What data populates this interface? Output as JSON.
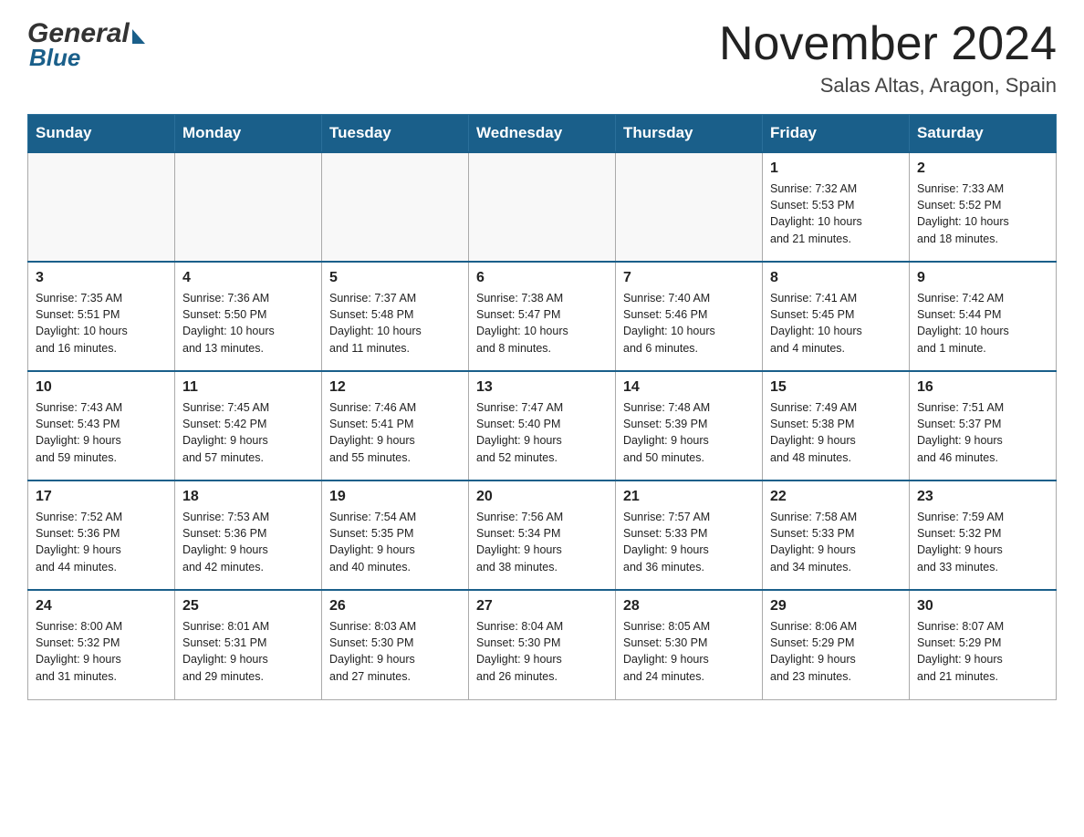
{
  "header": {
    "logo_general": "General",
    "logo_blue": "Blue",
    "month_year": "November 2024",
    "location": "Salas Altas, Aragon, Spain"
  },
  "weekdays": [
    "Sunday",
    "Monday",
    "Tuesday",
    "Wednesday",
    "Thursday",
    "Friday",
    "Saturday"
  ],
  "weeks": [
    {
      "days": [
        {
          "number": "",
          "info": ""
        },
        {
          "number": "",
          "info": ""
        },
        {
          "number": "",
          "info": ""
        },
        {
          "number": "",
          "info": ""
        },
        {
          "number": "",
          "info": ""
        },
        {
          "number": "1",
          "info": "Sunrise: 7:32 AM\nSunset: 5:53 PM\nDaylight: 10 hours\nand 21 minutes."
        },
        {
          "number": "2",
          "info": "Sunrise: 7:33 AM\nSunset: 5:52 PM\nDaylight: 10 hours\nand 18 minutes."
        }
      ]
    },
    {
      "days": [
        {
          "number": "3",
          "info": "Sunrise: 7:35 AM\nSunset: 5:51 PM\nDaylight: 10 hours\nand 16 minutes."
        },
        {
          "number": "4",
          "info": "Sunrise: 7:36 AM\nSunset: 5:50 PM\nDaylight: 10 hours\nand 13 minutes."
        },
        {
          "number": "5",
          "info": "Sunrise: 7:37 AM\nSunset: 5:48 PM\nDaylight: 10 hours\nand 11 minutes."
        },
        {
          "number": "6",
          "info": "Sunrise: 7:38 AM\nSunset: 5:47 PM\nDaylight: 10 hours\nand 8 minutes."
        },
        {
          "number": "7",
          "info": "Sunrise: 7:40 AM\nSunset: 5:46 PM\nDaylight: 10 hours\nand 6 minutes."
        },
        {
          "number": "8",
          "info": "Sunrise: 7:41 AM\nSunset: 5:45 PM\nDaylight: 10 hours\nand 4 minutes."
        },
        {
          "number": "9",
          "info": "Sunrise: 7:42 AM\nSunset: 5:44 PM\nDaylight: 10 hours\nand 1 minute."
        }
      ]
    },
    {
      "days": [
        {
          "number": "10",
          "info": "Sunrise: 7:43 AM\nSunset: 5:43 PM\nDaylight: 9 hours\nand 59 minutes."
        },
        {
          "number": "11",
          "info": "Sunrise: 7:45 AM\nSunset: 5:42 PM\nDaylight: 9 hours\nand 57 minutes."
        },
        {
          "number": "12",
          "info": "Sunrise: 7:46 AM\nSunset: 5:41 PM\nDaylight: 9 hours\nand 55 minutes."
        },
        {
          "number": "13",
          "info": "Sunrise: 7:47 AM\nSunset: 5:40 PM\nDaylight: 9 hours\nand 52 minutes."
        },
        {
          "number": "14",
          "info": "Sunrise: 7:48 AM\nSunset: 5:39 PM\nDaylight: 9 hours\nand 50 minutes."
        },
        {
          "number": "15",
          "info": "Sunrise: 7:49 AM\nSunset: 5:38 PM\nDaylight: 9 hours\nand 48 minutes."
        },
        {
          "number": "16",
          "info": "Sunrise: 7:51 AM\nSunset: 5:37 PM\nDaylight: 9 hours\nand 46 minutes."
        }
      ]
    },
    {
      "days": [
        {
          "number": "17",
          "info": "Sunrise: 7:52 AM\nSunset: 5:36 PM\nDaylight: 9 hours\nand 44 minutes."
        },
        {
          "number": "18",
          "info": "Sunrise: 7:53 AM\nSunset: 5:36 PM\nDaylight: 9 hours\nand 42 minutes."
        },
        {
          "number": "19",
          "info": "Sunrise: 7:54 AM\nSunset: 5:35 PM\nDaylight: 9 hours\nand 40 minutes."
        },
        {
          "number": "20",
          "info": "Sunrise: 7:56 AM\nSunset: 5:34 PM\nDaylight: 9 hours\nand 38 minutes."
        },
        {
          "number": "21",
          "info": "Sunrise: 7:57 AM\nSunset: 5:33 PM\nDaylight: 9 hours\nand 36 minutes."
        },
        {
          "number": "22",
          "info": "Sunrise: 7:58 AM\nSunset: 5:33 PM\nDaylight: 9 hours\nand 34 minutes."
        },
        {
          "number": "23",
          "info": "Sunrise: 7:59 AM\nSunset: 5:32 PM\nDaylight: 9 hours\nand 33 minutes."
        }
      ]
    },
    {
      "days": [
        {
          "number": "24",
          "info": "Sunrise: 8:00 AM\nSunset: 5:32 PM\nDaylight: 9 hours\nand 31 minutes."
        },
        {
          "number": "25",
          "info": "Sunrise: 8:01 AM\nSunset: 5:31 PM\nDaylight: 9 hours\nand 29 minutes."
        },
        {
          "number": "26",
          "info": "Sunrise: 8:03 AM\nSunset: 5:30 PM\nDaylight: 9 hours\nand 27 minutes."
        },
        {
          "number": "27",
          "info": "Sunrise: 8:04 AM\nSunset: 5:30 PM\nDaylight: 9 hours\nand 26 minutes."
        },
        {
          "number": "28",
          "info": "Sunrise: 8:05 AM\nSunset: 5:30 PM\nDaylight: 9 hours\nand 24 minutes."
        },
        {
          "number": "29",
          "info": "Sunrise: 8:06 AM\nSunset: 5:29 PM\nDaylight: 9 hours\nand 23 minutes."
        },
        {
          "number": "30",
          "info": "Sunrise: 8:07 AM\nSunset: 5:29 PM\nDaylight: 9 hours\nand 21 minutes."
        }
      ]
    }
  ]
}
